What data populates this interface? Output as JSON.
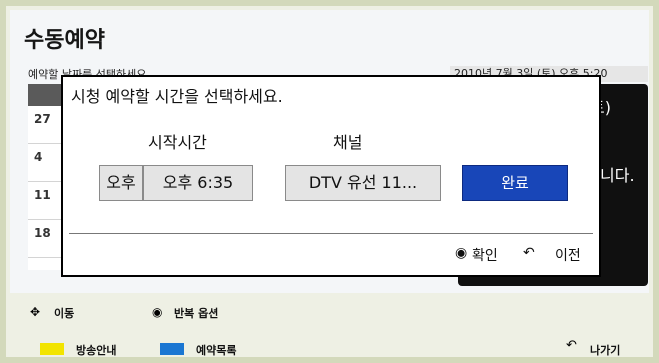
{
  "header": {
    "title": "수동예약"
  },
  "background": {
    "instruction": "예약할 날짜를 선택하세요.",
    "datetime": "2010년 7월 3일 (토) 오후 5:20",
    "calendar_days": [
      "27",
      "4",
      "11",
      "18"
    ],
    "side_panel": {
      "line1": "토)",
      "line2": "니다."
    }
  },
  "dialog": {
    "title": "시청 예약할 시간을 선택하세요.",
    "start_time_label": "시작시간",
    "channel_label": "채널",
    "ampm_value": "오후",
    "time_value": "오후 6:35",
    "channel_value": "DTV 유선 11...",
    "done_label": "완료",
    "confirm_label": "확인",
    "back_label": "이전",
    "confirm_icon": "circle-dot-icon",
    "back_icon": "return-arrow-icon"
  },
  "footer": {
    "move_label": "이동",
    "repeat_label": "반복 옵션",
    "guide_label": "방송안내",
    "reservation_list_label": "예약목록",
    "exit_label": "나가기",
    "guide_color": "#f2e400",
    "list_color": "#1a76d2"
  },
  "colors": {
    "accent": "#1846b8",
    "background": "#d3d9bb",
    "panel": "#101010"
  }
}
